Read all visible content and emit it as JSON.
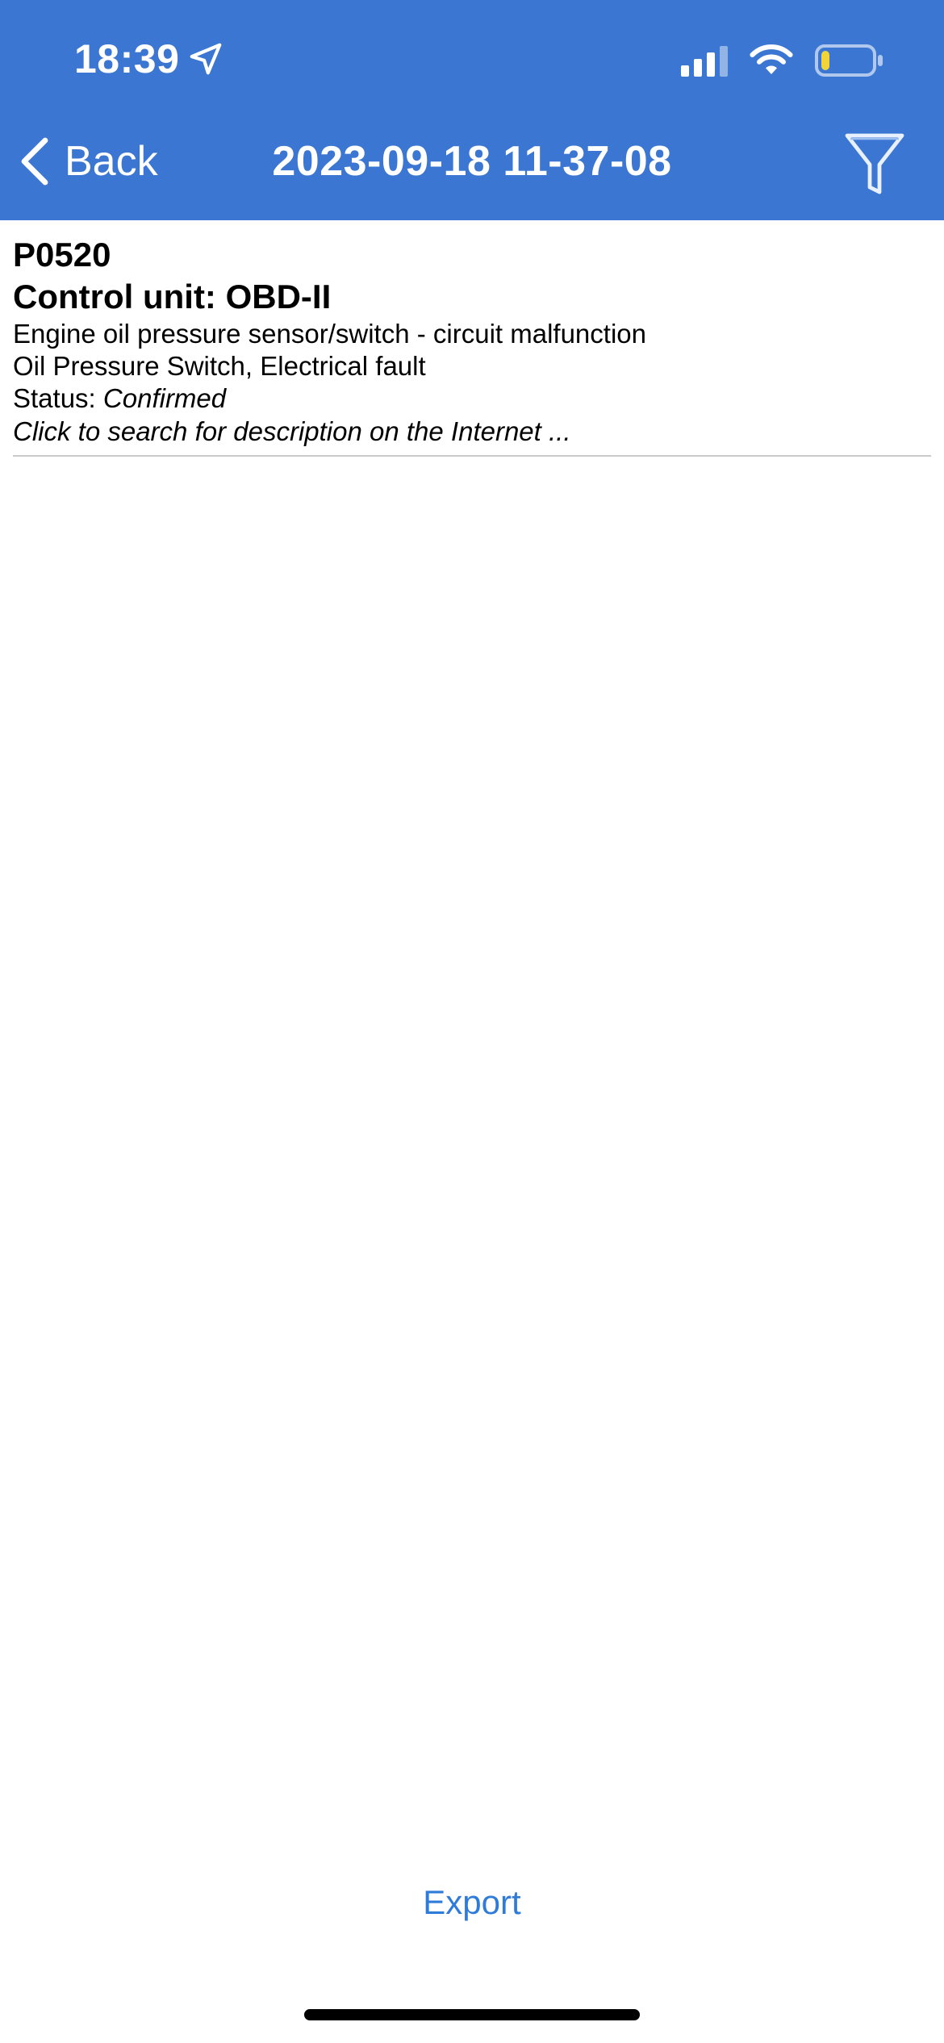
{
  "status_bar": {
    "time": "18:39"
  },
  "nav": {
    "back_label": "Back",
    "title": "2023-09-18 11-37-08"
  },
  "fault": {
    "code": "P0520",
    "control_unit": "Control unit: OBD-II",
    "description": "Engine oil pressure sensor/switch - circuit malfunction",
    "detail": "Oil Pressure Switch, Electrical fault",
    "status_label": "Status:",
    "status_value": "Confirmed",
    "search_hint": "Click to search for description on the Internet ..."
  },
  "footer": {
    "export_label": "Export"
  },
  "colors": {
    "header_bg": "#3a76d2",
    "accent": "#2f7bd9",
    "battery_fill": "#f2d33a"
  }
}
